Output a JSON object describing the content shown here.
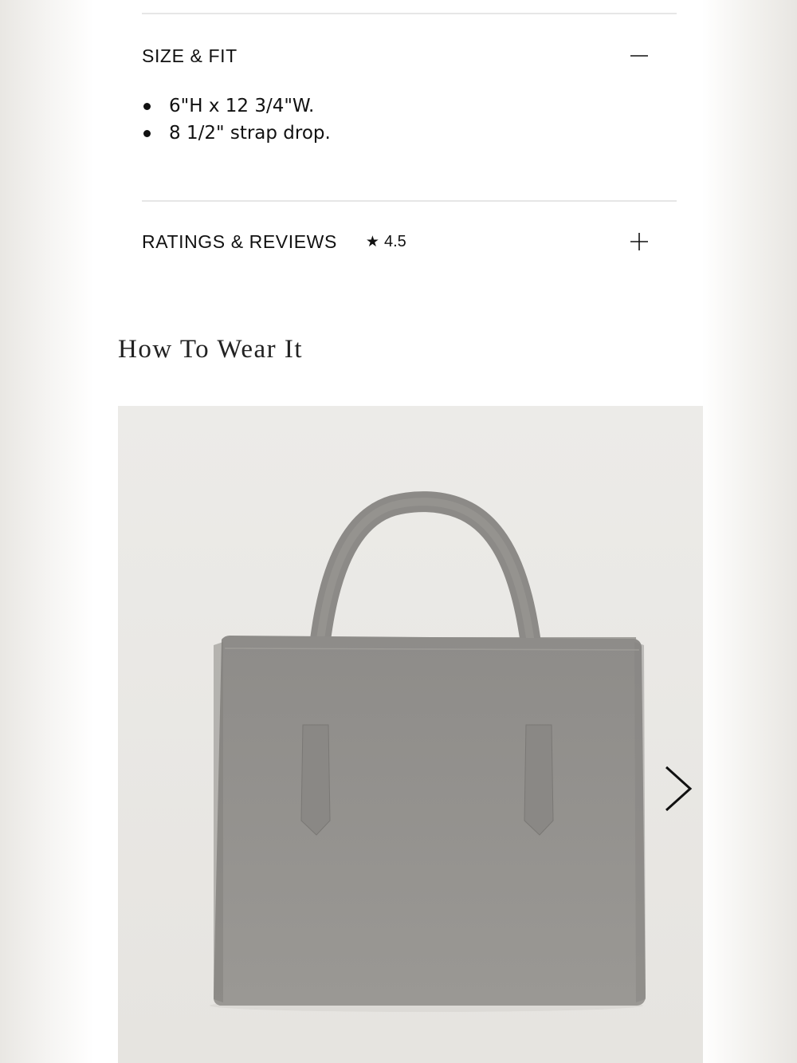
{
  "size_fit": {
    "title": "SIZE & FIT",
    "toggle_icon": "minus-icon",
    "expanded": true,
    "bullets": [
      "6\"H x 12 3/4\"W.",
      "8 1/2\" strap drop."
    ]
  },
  "ratings_reviews": {
    "title": "RATINGS & REVIEWS",
    "star_icon": "star-icon",
    "rating": "4.5",
    "toggle_icon": "plus-icon",
    "expanded": false
  },
  "how_to_wear": {
    "title": "How To Wear It",
    "image": {
      "subject": "grey suede east-west shoulder bag",
      "background_color": "#ecebe8",
      "bag_color": "#8f8d8a"
    },
    "next_icon": "chevron-right-icon"
  }
}
